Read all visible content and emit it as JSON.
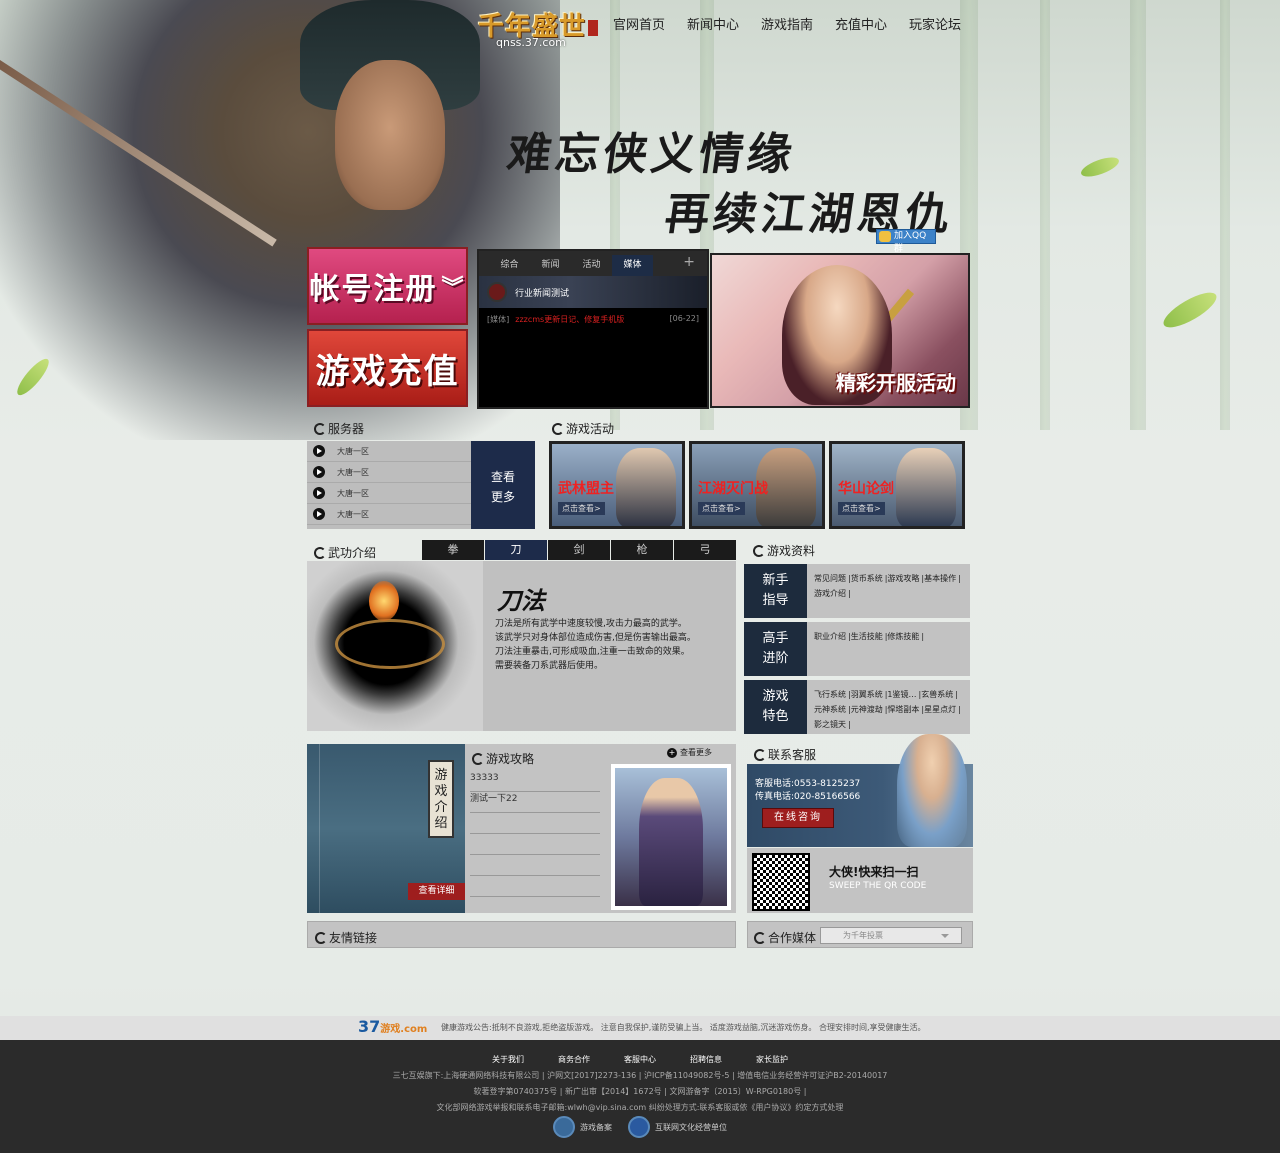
{
  "logo": {
    "title": "千年盛世",
    "url_text": "qnss.37.com"
  },
  "nav": [
    "官网首页",
    "新闻中心",
    "游戏指南",
    "充值中心",
    "玩家论坛"
  ],
  "slogan": {
    "line1": "难忘侠义情缘",
    "line2": "再续江湖恩仇"
  },
  "qq_button": "加入QQ群",
  "buttons": {
    "register": "帐号注册",
    "recharge": "游戏充值"
  },
  "news": {
    "tabs": [
      "综合",
      "新闻",
      "活动",
      "媒体"
    ],
    "active_tab": "媒体",
    "plus": "+",
    "headline": "行业新闻测试",
    "items": [
      {
        "category": "[媒体]",
        "title": "zzzcms更新日记、修复手机版",
        "date": "[06-22]"
      }
    ]
  },
  "banner": {
    "caption": "精彩开服活动"
  },
  "servers": {
    "title": "服务器",
    "items": [
      "大唐一区",
      "大唐一区",
      "大唐一区",
      "大唐一区"
    ],
    "more_line1": "查看",
    "more_line2": "更多"
  },
  "activities": {
    "title": "游戏活动",
    "items": [
      {
        "name": "武林盟主",
        "sub": "点击查看>"
      },
      {
        "name": "江湖灭门战",
        "sub": "点击查看>"
      },
      {
        "name": "华山论剑",
        "sub": "点击查看>"
      }
    ]
  },
  "wugong": {
    "title": "武功介绍",
    "tabs": [
      "拳",
      "刀",
      "剑",
      "枪",
      "弓"
    ],
    "active_tab": "刀",
    "heading": "刀法",
    "desc": [
      "刀法是所有武学中速度较慢,攻击力最高的武学。",
      "该武学只对身体部位造成伤害,但是伤害输出最高。",
      "刀法注重暴击,可形成吸血,注重一击致命的效果。",
      "需要装备刀系武器后使用。"
    ]
  },
  "game_info": {
    "title": "游戏资料",
    "groups": [
      {
        "label1": "新手",
        "label2": "指导",
        "links": [
          "常见问题",
          "货币系统",
          "游戏攻略",
          "基本操作",
          "游戏介绍"
        ]
      },
      {
        "label1": "高手",
        "label2": "进阶",
        "links": [
          "职业介绍",
          "生活技能",
          "修炼技能"
        ]
      },
      {
        "label1": "游戏",
        "label2": "特色",
        "links": [
          "飞行系统",
          "羽翼系统",
          "1鉴镜…",
          "玄兽系统",
          "元神系统",
          "元神渡劫",
          "悍塔副本",
          "星星点灯",
          "影之镜天"
        ]
      }
    ]
  },
  "guide": {
    "card": "游戏介绍",
    "detail_button": "查看详细",
    "title": "游戏攻略",
    "more": "查看更多",
    "items": [
      "33333",
      "测试一下22",
      "",
      "",
      "",
      ""
    ]
  },
  "contact": {
    "title": "联系客服",
    "phone": "客服电话:0553-8125237",
    "fax": "传真电话:020-85166566",
    "online": "在线咨询",
    "qr_title": "大侠!快来扫一扫",
    "qr_sub": "SWEEP THE QR CODE"
  },
  "links": {
    "friend_title": "友情链接",
    "media_title": "合作媒体",
    "media_select": "为千年投票"
  },
  "footer": {
    "brand": "37",
    "brand_game": "游戏",
    "brand_com": ".com",
    "notice": "健康游戏公告:抵制不良游戏,拒绝盗版游戏。 注意自我保护,谨防受骗上当。 适度游戏益脑,沉迷游戏伤身。 合理安排时间,享受健康生活。",
    "nav": [
      "关于我们",
      "商务合作",
      "客服中心",
      "招聘信息",
      "家长监护"
    ],
    "line1": "三七互娱旗下:上海硬通网络科技有限公司 | 沪网文[2017]2273-136 | 沪ICP备11049082号-5 | 增值电信业务经营许可证沪B2-20140017",
    "line2": "软著登字第0740375号 | 新广出审【2014】1672号 | 文网游备字〔2015〕W-RPG0180号 |",
    "line3": "文化部网络游戏举报和联系电子邮箱:wlwh@vip.sina.com 纠纷处理方式:联系客服或依《用户协议》约定方式处理",
    "badge1": "游戏备案",
    "badge2": "互联网文化经营单位"
  }
}
